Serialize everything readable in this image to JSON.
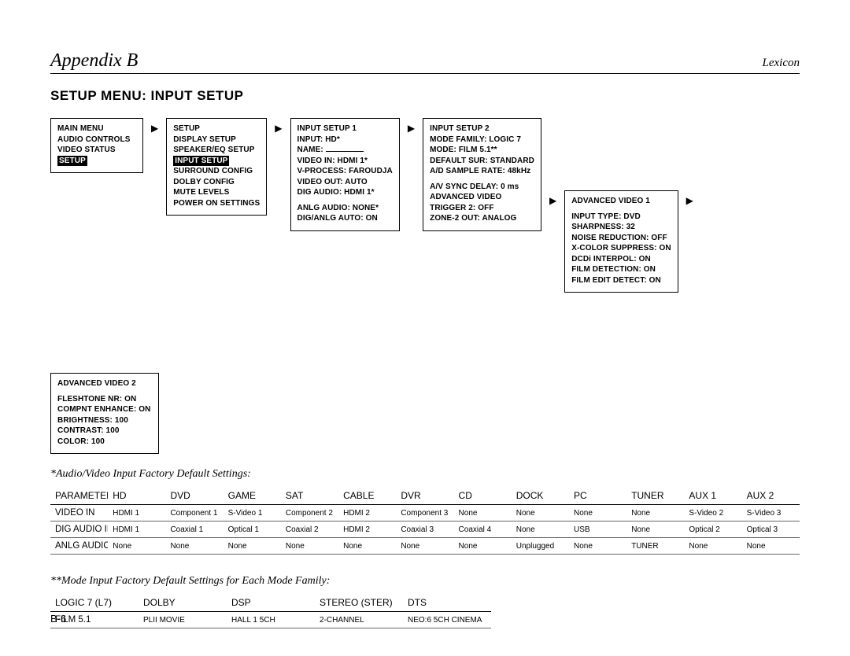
{
  "header": {
    "appendix": "Appendix B",
    "brand": "Lexicon"
  },
  "section_title": "SETUP MENU: INPUT SETUP",
  "menus": {
    "m1": {
      "items": [
        "MAIN MENU",
        "AUDIO CONTROLS",
        "VIDEO STATUS"
      ],
      "selected": "SETUP"
    },
    "m2": {
      "title": "SETUP",
      "before": [
        "DISPLAY SETUP",
        "SPEAKER/EQ SETUP"
      ],
      "selected": "INPUT SETUP",
      "after": [
        "SURROUND CONFIG",
        "DOLBY CONFIG",
        "MUTE LEVELS",
        "POWER ON SETTINGS"
      ]
    },
    "m3": {
      "title": "INPUT SETUP 1",
      "rows": [
        "INPUT: HD*",
        "NAME: ",
        "VIDEO IN: HDMI 1*",
        "V-PROCESS: FAROUDJA",
        "VIDEO OUT: AUTO",
        "DIG AUDIO: HDMI 1*",
        "",
        "ANLG AUDIO: NONE*",
        "DIG/ANLG AUTO: ON"
      ]
    },
    "m4": {
      "title": "INPUT SETUP 2",
      "rows": [
        "MODE FAMILY: LOGIC 7",
        "MODE: FILM 5.1**",
        "DEFAULT SUR: STANDARD",
        "A/D SAMPLE RATE: 48kHz",
        "",
        "A/V SYNC DELAY: 0 ms",
        "ADVANCED VIDEO",
        "TRIGGER 2: OFF",
        "ZONE-2 OUT: ANALOG"
      ]
    },
    "m5": {
      "title": "ADVANCED VIDEO 1",
      "rows": [
        "",
        "INPUT TYPE: DVD",
        "SHARPNESS: 32",
        "NOISE REDUCTION: OFF",
        "X-COLOR SUPPRESS: ON",
        "DCDi INTERPOL: ON",
        "FILM DETECTION: ON",
        "FILM EDIT DETECT: ON"
      ]
    },
    "m6": {
      "title": "ADVANCED VIDEO 2",
      "rows": [
        "",
        "FLESHTONE NR: ON",
        "COMPNT ENHANCE: ON",
        "BRIGHTNESS: 100",
        "CONTRAST: 100",
        "COLOR: 100"
      ]
    }
  },
  "table1": {
    "note": "*Audio/Video Input Factory Default Settings:",
    "headers": [
      "PARAMETER",
      "HD",
      "DVD",
      "GAME",
      "SAT",
      "CABLE",
      "DVR",
      "CD",
      "DOCK",
      "PC",
      "TUNER",
      "AUX 1",
      "AUX 2"
    ],
    "rows": [
      [
        "VIDEO IN",
        "HDMI 1",
        "Component 1",
        "S-Video 1",
        "Component 2",
        "HDMI 2",
        "Component 3",
        "None",
        "None",
        "None",
        "None",
        "S-Video 2",
        "S-Video 3"
      ],
      [
        "DIG AUDIO IN",
        "HDMI 1",
        "Coaxial 1",
        "Optical 1",
        "Coaxial 2",
        "HDMI 2",
        "Coaxial 3",
        "Coaxial 4",
        "None",
        "USB",
        "None",
        "Optical 2",
        "Optical 3"
      ],
      [
        "ANLG AUDIO IN",
        "None",
        "None",
        "None",
        "None",
        "None",
        "None",
        "None",
        "Unplugged",
        "None",
        "TUNER",
        "None",
        "None"
      ]
    ]
  },
  "table2": {
    "note": "**Mode Input Factory Default Settings for Each Mode Family:",
    "headers": [
      "LOGIC 7 (L7)",
      "DOLBY",
      "DSP",
      "STEREO (STER)",
      "DTS"
    ],
    "rows": [
      [
        "FILM 5.1",
        "PLII MOVIE",
        "HALL 1 5CH",
        "2-CHANNEL",
        "NEO:6 5CH CINEMA"
      ]
    ]
  },
  "page_number": "B-6"
}
